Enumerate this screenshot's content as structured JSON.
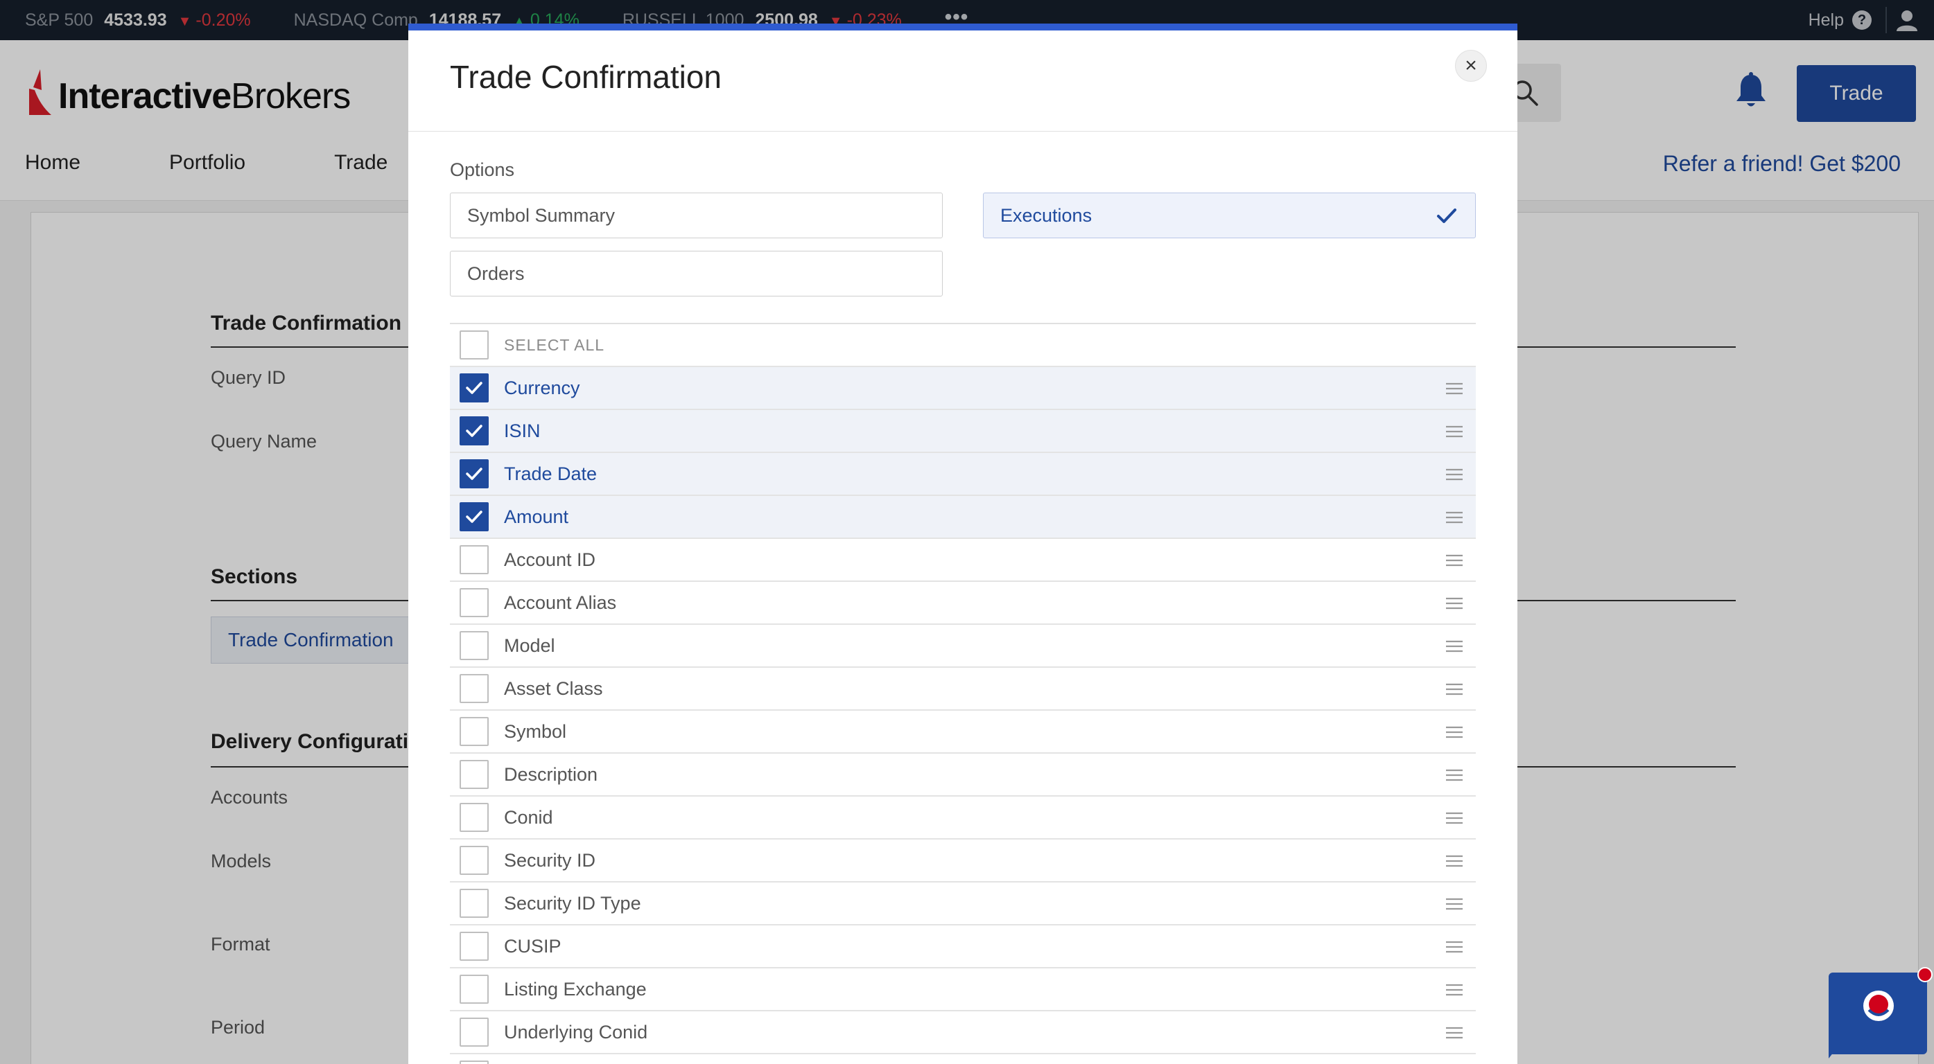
{
  "ticker": {
    "items": [
      {
        "name": "S&P 500",
        "value": "4533.93",
        "change": "-0.20%",
        "direction": "down"
      },
      {
        "name": "NASDAQ Comp",
        "value": "14188.57",
        "change": "0.14%",
        "direction": "up"
      },
      {
        "name": "RUSSELL 1000",
        "value": "2500.98",
        "change": "-0.23%",
        "direction": "down"
      }
    ],
    "more": "•••",
    "help_label": "Help",
    "help_q": "?"
  },
  "header": {
    "logo_bold": "Interactive",
    "logo_regular": "Brokers",
    "trade_button": "Trade",
    "nav": [
      "Home",
      "Portfolio",
      "Trade"
    ],
    "refer": "Refer a friend! Get $200"
  },
  "background": {
    "section_trade_confirmation": "Trade Confirmation I",
    "query_id": "Query ID",
    "query_name": "Query Name",
    "sections": "Sections",
    "section_tab": "Trade Confirmation",
    "delivery": "Delivery Configurati",
    "accounts": "Accounts",
    "models": "Models",
    "format": "Format",
    "period": "Period"
  },
  "modal": {
    "title": "Trade Confirmation",
    "close": "×",
    "options_label": "Options",
    "options": [
      {
        "label": "Symbol Summary",
        "selected": false
      },
      {
        "label": "Executions",
        "selected": true
      },
      {
        "label": "Orders",
        "selected": false
      }
    ],
    "select_all": "SELECT ALL",
    "columns": [
      {
        "label": "Currency",
        "checked": true
      },
      {
        "label": "ISIN",
        "checked": true
      },
      {
        "label": "Trade Date",
        "checked": true
      },
      {
        "label": "Amount",
        "checked": true
      },
      {
        "label": "Account ID",
        "checked": false
      },
      {
        "label": "Account Alias",
        "checked": false
      },
      {
        "label": "Model",
        "checked": false
      },
      {
        "label": "Asset Class",
        "checked": false
      },
      {
        "label": "Symbol",
        "checked": false
      },
      {
        "label": "Description",
        "checked": false
      },
      {
        "label": "Conid",
        "checked": false
      },
      {
        "label": "Security ID",
        "checked": false
      },
      {
        "label": "Security ID Type",
        "checked": false
      },
      {
        "label": "CUSIP",
        "checked": false
      },
      {
        "label": "Listing Exchange",
        "checked": false
      },
      {
        "label": "Underlying Conid",
        "checked": false
      },
      {
        "label": "",
        "checked": false
      }
    ]
  },
  "colors": {
    "brand_blue": "#1f4a9d",
    "accent_bar": "#2f5bd0",
    "ticker_bg": "#161f2c",
    "down": "#e0383e",
    "up": "#27a85a",
    "logo_red": "#d81e2a"
  }
}
